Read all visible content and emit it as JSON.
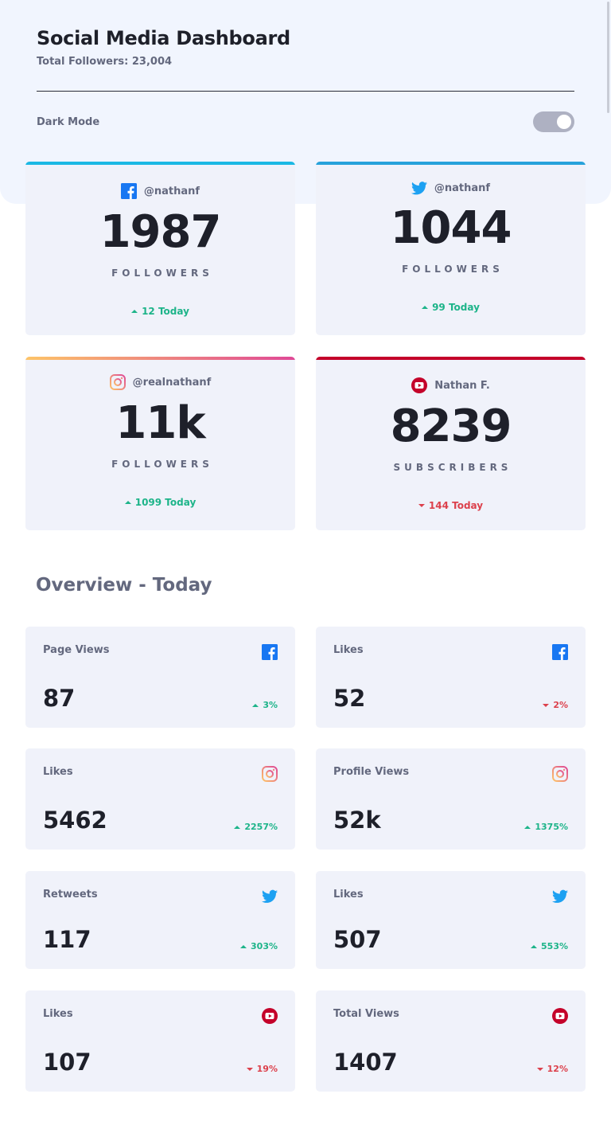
{
  "header": {
    "title": "Social Media Dashboard",
    "total_followers": "Total Followers: 23,004",
    "dark_mode_label": "Dark Mode"
  },
  "colors": {
    "facebook": "#1877f2",
    "twitter": "#1da1f2",
    "instagram_gradient": [
      "#fdc468",
      "#df4996"
    ],
    "youtube": "#c4032a",
    "up": "#1db489",
    "down": "#dc414c"
  },
  "cards": [
    {
      "platform": "facebook",
      "icon": "facebook-icon",
      "handle": "@nathanf",
      "count": "1987",
      "unit": "FOLLOWERS",
      "change": "12 Today",
      "trend": "up"
    },
    {
      "platform": "twitter",
      "icon": "twitter-icon",
      "handle": "@nathanf",
      "count": "1044",
      "unit": "FOLLOWERS",
      "change": "99 Today",
      "trend": "up"
    },
    {
      "platform": "instagram",
      "icon": "instagram-icon",
      "handle": "@realnathanf",
      "count": "11k",
      "unit": "FOLLOWERS",
      "change": "1099 Today",
      "trend": "up"
    },
    {
      "platform": "youtube",
      "icon": "youtube-icon",
      "handle": "Nathan F.",
      "count": "8239",
      "unit": "SUBSCRIBERS",
      "change": "144 Today",
      "trend": "down"
    }
  ],
  "overview": {
    "title": "Overview - Today",
    "items": [
      {
        "label": "Page Views",
        "icon": "facebook-icon",
        "value": "87",
        "change": "3%",
        "trend": "up"
      },
      {
        "label": "Likes",
        "icon": "facebook-icon",
        "value": "52",
        "change": "2%",
        "trend": "down"
      },
      {
        "label": "Likes",
        "icon": "instagram-icon",
        "value": "5462",
        "change": "2257%",
        "trend": "up"
      },
      {
        "label": "Profile Views",
        "icon": "instagram-icon",
        "value": "52k",
        "change": "1375%",
        "trend": "up"
      },
      {
        "label": "Retweets",
        "icon": "twitter-icon",
        "value": "117",
        "change": "303%",
        "trend": "up"
      },
      {
        "label": "Likes",
        "icon": "twitter-icon",
        "value": "507",
        "change": "553%",
        "trend": "up"
      },
      {
        "label": "Likes",
        "icon": "youtube-icon",
        "value": "107",
        "change": "19%",
        "trend": "down"
      },
      {
        "label": "Total Views",
        "icon": "youtube-icon",
        "value": "1407",
        "change": "12%",
        "trend": "down"
      }
    ]
  }
}
